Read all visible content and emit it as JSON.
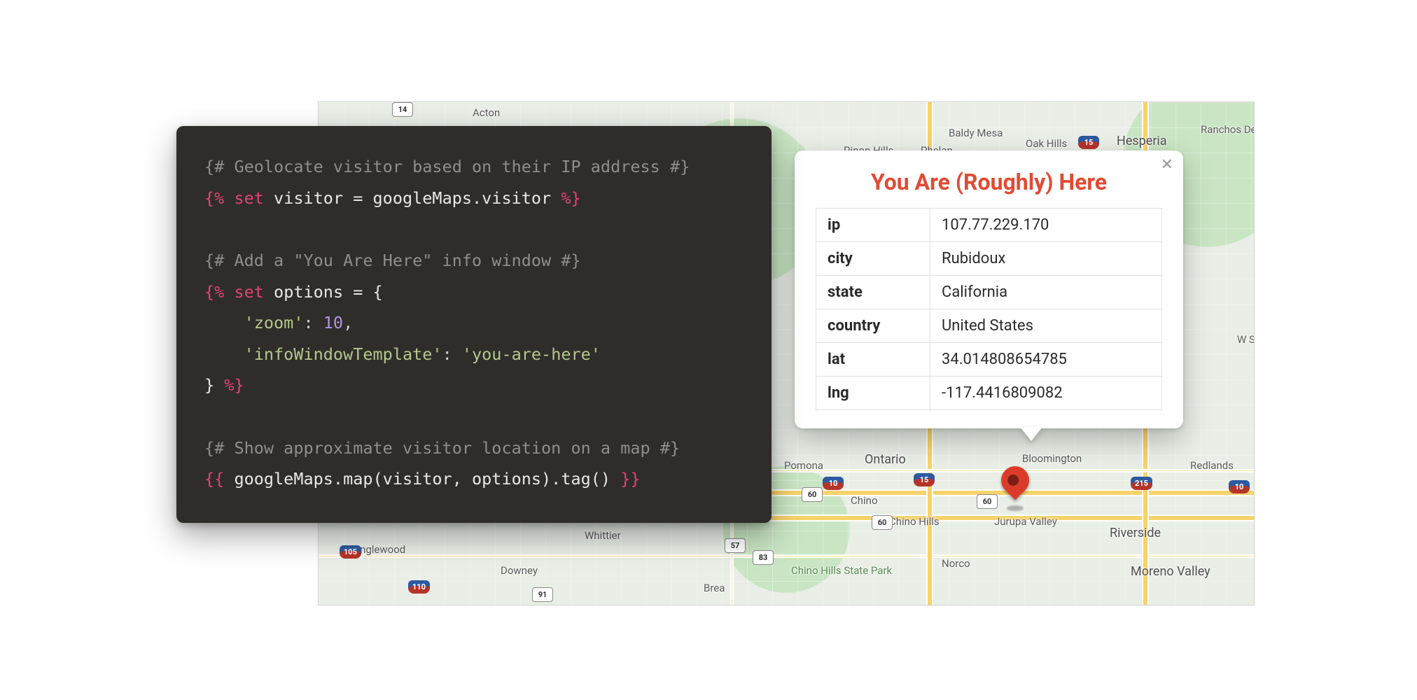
{
  "code": {
    "comment1": "{# Geolocate visitor based on their IP address #}",
    "line1_open": "{%",
    "line1_set": "set",
    "line1_rest": " visitor = googleMaps.visitor ",
    "line1_close": "%}",
    "comment2": "{# Add a \"You Are Here\" info window #}",
    "line2_open": "{%",
    "line2_set": "set",
    "line2_rest": " options = {",
    "line3_key": "'zoom'",
    "line3_colon": ": ",
    "line3_val": "10",
    "line3_comma": ",",
    "line4_key": "'infoWindowTemplate'",
    "line4_colon": ": ",
    "line4_val": "'you-are-here'",
    "line5_close_brace": "} ",
    "line5_close": "%}",
    "comment3": "{# Show approximate visitor location on a map #}",
    "line6_open": "{{",
    "line6_body": " googleMaps.map(visitor, options).tag() ",
    "line6_close": "}}"
  },
  "info_window": {
    "title": "You Are (Roughly) Here",
    "rows": {
      "ip_k": "ip",
      "ip_v": "107.77.229.170",
      "city_k": "city",
      "city_v": "Rubidoux",
      "state_k": "state",
      "state_v": "California",
      "country_k": "country",
      "country_v": "United States",
      "lat_k": "lat",
      "lat_v": "34.014808654785",
      "lng_k": "lng",
      "lng_v": "-117.4416809082"
    },
    "close_glyph": "✕"
  },
  "map_labels": {
    "acton": "Acton",
    "baldymesa": "Baldy Mesa",
    "pinonhills": "Pinon Hills",
    "phelan": "Phelan",
    "oakhills": "Oak Hills",
    "hesperia": "Hesperia",
    "ranchos": "Ranchos\nDel Oro",
    "wsprings": "W\nSpri",
    "pomona": "Pomona",
    "ontario": "Ontario",
    "chino": "Chino",
    "chinohills": "Chino Hills",
    "chpark": "Chino Hills\nState Park",
    "jurupa": "Jurupa Valley",
    "bloomington": "Bloomington",
    "riverside": "Riverside",
    "redlands": "Redlands",
    "moreno": "Moreno Valley",
    "norco": "Norco",
    "inglewood": "Inglewood",
    "downey": "Downey",
    "whittier": "Whittier",
    "brea": "Brea"
  },
  "shields": {
    "s14": "14",
    "s15": "15",
    "s15b": "15",
    "s215": "215",
    "s10": "10",
    "s10b": "10",
    "s105": "105",
    "s110": "110",
    "s60": "60",
    "s60b": "60",
    "s60c": "60",
    "s91": "91",
    "s57": "57",
    "s83": "83"
  }
}
